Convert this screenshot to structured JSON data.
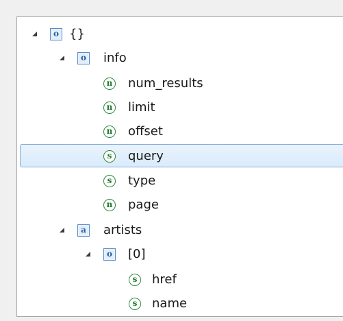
{
  "tree": {
    "root": {
      "icon": "o",
      "label": "{}"
    },
    "info": {
      "icon": "o",
      "label": "info"
    },
    "num_results": {
      "icon": "n",
      "label": "num_results"
    },
    "limit": {
      "icon": "n",
      "label": "limit"
    },
    "offset": {
      "icon": "n",
      "label": "offset"
    },
    "query": {
      "icon": "s",
      "label": "query"
    },
    "type": {
      "icon": "s",
      "label": "type"
    },
    "page": {
      "icon": "n",
      "label": "page"
    },
    "artists": {
      "icon": "a",
      "label": "artists"
    },
    "item0": {
      "icon": "o",
      "label": "[0]"
    },
    "href": {
      "icon": "s",
      "label": "href"
    },
    "name": {
      "icon": "s",
      "label": "name"
    }
  },
  "selected": "query",
  "colors": {
    "object_icon": "#5a8cc6",
    "scalar_icon": "#2f8a3c",
    "selection_border": "#84acdd",
    "selection_fill": "#dceaf9"
  },
  "icon_names": {
    "o": "object-icon",
    "a": "array-icon",
    "n": "number-icon",
    "s": "string-icon"
  }
}
